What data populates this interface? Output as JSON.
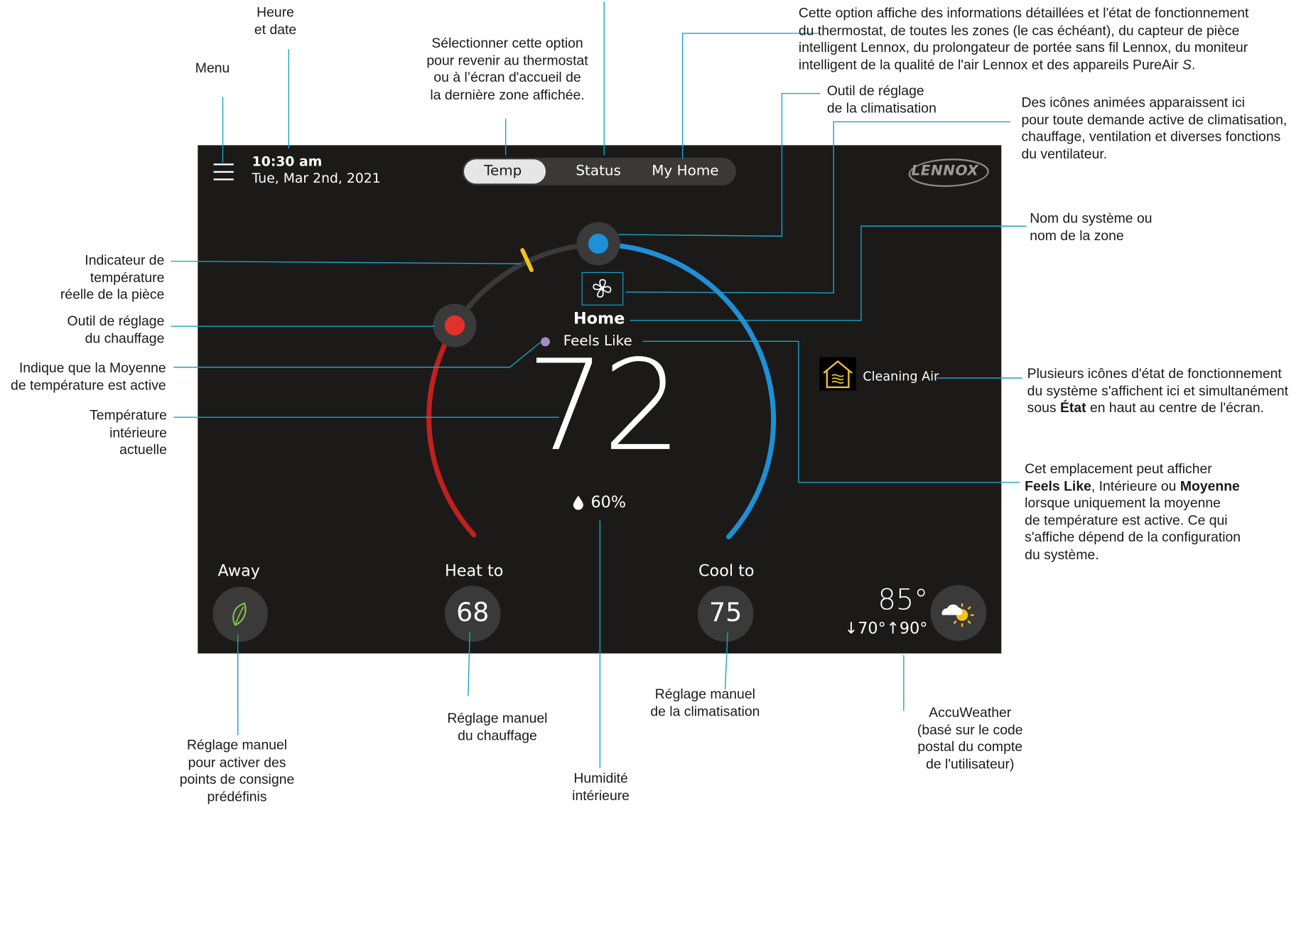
{
  "screen": {
    "time": "10:30 am",
    "date": "Tue, Mar 2nd, 2021",
    "tabs": [
      "Temp",
      "Status",
      "My Home"
    ],
    "active_tab": "Temp",
    "brand": "LENNOX",
    "zone_name": "Home",
    "feels_like_label": "Feels Like",
    "current_temp": "72",
    "humidity": "60%",
    "status_icon_label": "Cleaning Air",
    "away_label": "Away",
    "heat_label": "Heat to",
    "heat_value": "68",
    "cool_label": "Cool to",
    "cool_value": "75",
    "weather_temp": "85°",
    "weather_low": "↓70°",
    "weather_high": "↑90°",
    "colors": {
      "background": "#1b1a19",
      "heat": "#e0312c",
      "cool": "#1f8fd6",
      "callout": "#1aa3c4",
      "indicator": "#f2c31b"
    },
    "icons": [
      "menu-icon",
      "fan-icon",
      "humidity-drop-icon",
      "house-air-icon",
      "leaf-icon",
      "partly-sunny-icon"
    ]
  },
  "annotations": {
    "heure": "Heure\net date",
    "menu": "Menu",
    "temp_tab": "Sélectionner cette option\npour revenir au thermostat\nou à l’écran d'accueil de\nla dernière zone affichée.",
    "my_home_1": "Cette option affiche des informations détaillées et l'état de fonctionnement\ndu thermostat, de toutes les zones (le cas échéant), du capteur de pièce\nintelligent Lennox, du prolongateur de portée sans fil Lennox, du moniteur\nintelligent de la qualité de l'air Lennox et des appareils PureAir ",
    "my_home_2": "S",
    "my_home_3": ".",
    "cool_tool": "Outil de réglage\nde la climatisation",
    "animated_icons": "Des icônes animées apparaissent ici\npour toute demande active de climatisation,\nchauffage, ventilation et diverses fonctions\ndu ventilateur.",
    "system_name": "Nom du système ou\nnom de la zone",
    "real_temp": "Indicateur de\ntempérature\nréelle de la pièce",
    "heat_tool": "Outil de réglage\ndu chauffage",
    "average": "Indique que la Moyenne\nde température est active",
    "indoor_temp": "Température\nintérieure\nactuelle",
    "status_icons_1": "Plusieurs icônes d'état de fonctionnement\ndu système s'affichent ici et simultanément\nsous ",
    "status_icons_2": "État",
    "status_icons_3": " en haut au centre de l'écran.",
    "feels_1": "Cet emplacement peut afficher\n",
    "feels_2": "Feels Like",
    "feels_3": ", Intérieure ou ",
    "feels_4": "Moyenne",
    "feels_5": "\nlorsque uniquement la moyenne\nde température est active. Ce qui\ns'affiche dépend de la configuration\ndu système.",
    "away_manual": "Réglage manuel\npour activer des\npoints de consigne\nprédéfinis",
    "heat_manual": "Réglage manuel\ndu chauffage",
    "humidity": "Humidité\nintérieure",
    "cool_manual": "Réglage manuel\nde la climatisation",
    "accuweather": "AccuWeather\n(basé sur le code\npostal du compte\nde l'utilisateur)"
  }
}
